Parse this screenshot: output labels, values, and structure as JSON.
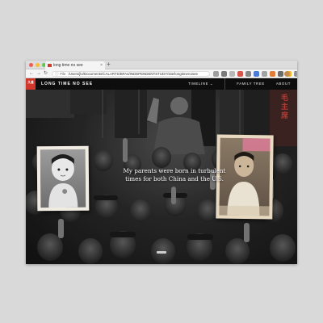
{
  "browser": {
    "tab_title": "long time no see",
    "tab_close": "×",
    "new_tab": "+",
    "back": "←",
    "forward": "→",
    "reload": "↻",
    "url_info": "ⓘ",
    "url_label": "File",
    "url": "/Users/jlo/Documents/CALARTS/BFA4/INDEPENDENTSTUDY/site/longtimenosee",
    "menu": "⋮",
    "window_dot_colors": [
      "#ee5d55",
      "#f5bc3a",
      "#5fc74f"
    ],
    "extension_colors": [
      "#9f9f9f",
      "#7a7a7a",
      "#b8b8b8",
      "#d5574c",
      "#888888",
      "#4b7bd6",
      "#a3a3a3",
      "#e07d3a",
      "#6b6b6b",
      "#f0b429",
      "#999999",
      "#5e5e5e"
    ]
  },
  "site": {
    "logo": "久違",
    "brand": "LONG TIME NO SEE",
    "nav": [
      {
        "label": "TIMELINE ⌄"
      },
      {
        "label": "FAMILY TREE"
      },
      {
        "label": "ABOUT"
      }
    ],
    "hero_line1": "My parents were born in turbulent",
    "hero_line2": "times for both China and the U.S.",
    "banner_text": "毛主席",
    "accent": "#d2372b"
  }
}
